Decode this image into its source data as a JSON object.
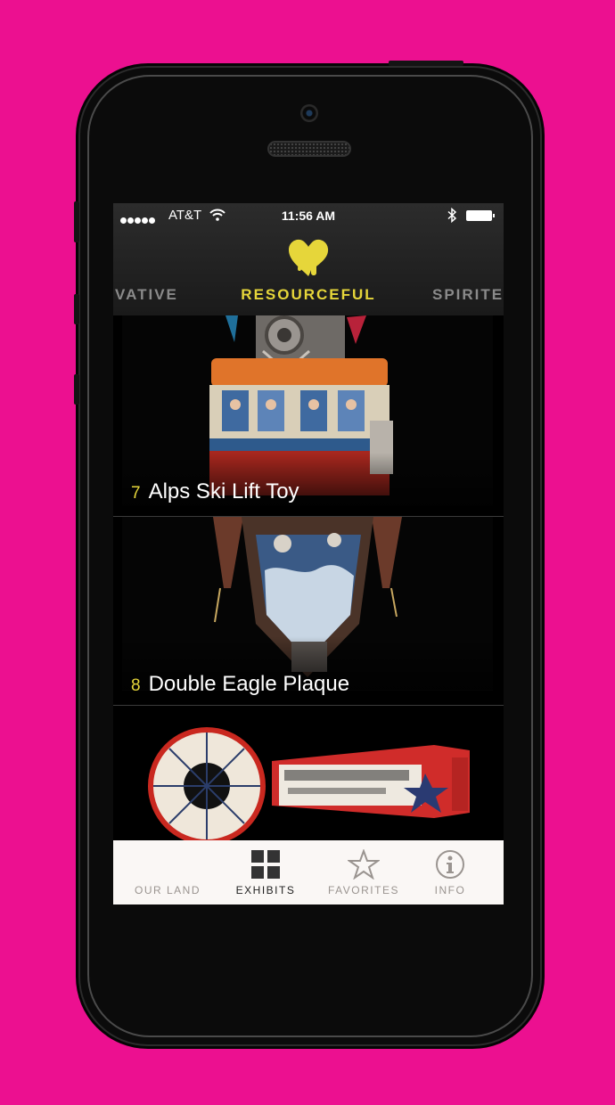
{
  "status_bar": {
    "carrier": "AT&T",
    "time": "11:56 AM"
  },
  "categories": {
    "previous": "VATIVE",
    "current": "RESOURCEFUL",
    "next": "SPIRITE"
  },
  "exhibits": [
    {
      "number": "7",
      "title": "Alps Ski Lift Toy"
    },
    {
      "number": "8",
      "title": "Double Eagle Plaque"
    },
    {
      "number": "",
      "title": ""
    }
  ],
  "tabs": [
    {
      "label": "OUR LAND",
      "icon": "our-land-icon",
      "active": false
    },
    {
      "label": "EXHIBITS",
      "icon": "grid-icon",
      "active": true
    },
    {
      "label": "FAVORITES",
      "icon": "star-icon",
      "active": false
    },
    {
      "label": "INFO",
      "icon": "info-icon",
      "active": false
    }
  ],
  "colors": {
    "background": "#ec1090",
    "accent": "#e6d63a",
    "tabbar": "#faf7f5"
  }
}
